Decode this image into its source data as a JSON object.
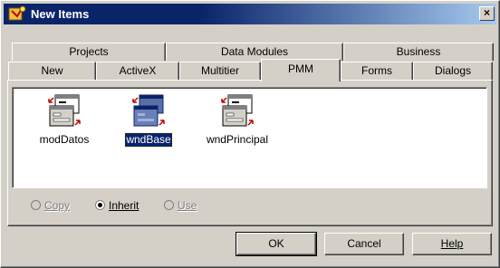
{
  "window": {
    "title": "New Items",
    "close_glyph": "×"
  },
  "tabs": {
    "row1": [
      "Projects",
      "Data Modules",
      "Business"
    ],
    "row2": [
      "New",
      "ActiveX",
      "Multitier",
      "PMM",
      "Forms",
      "Dialogs"
    ],
    "active": "PMM"
  },
  "items": [
    {
      "label": "modDatos",
      "icon": "form-template-icon",
      "selected": false
    },
    {
      "label": "wndBase",
      "icon": "form-template-icon",
      "selected": true
    },
    {
      "label": "wndPrincipal",
      "icon": "form-template-icon",
      "selected": false
    }
  ],
  "options": {
    "copy": {
      "label": "Copy",
      "enabled": false,
      "checked": false
    },
    "inherit": {
      "label": "Inherit",
      "enabled": true,
      "checked": true
    },
    "use": {
      "label": "Use",
      "enabled": false,
      "checked": false
    }
  },
  "buttons": {
    "ok": "OK",
    "cancel": "Cancel",
    "help": "Help"
  }
}
